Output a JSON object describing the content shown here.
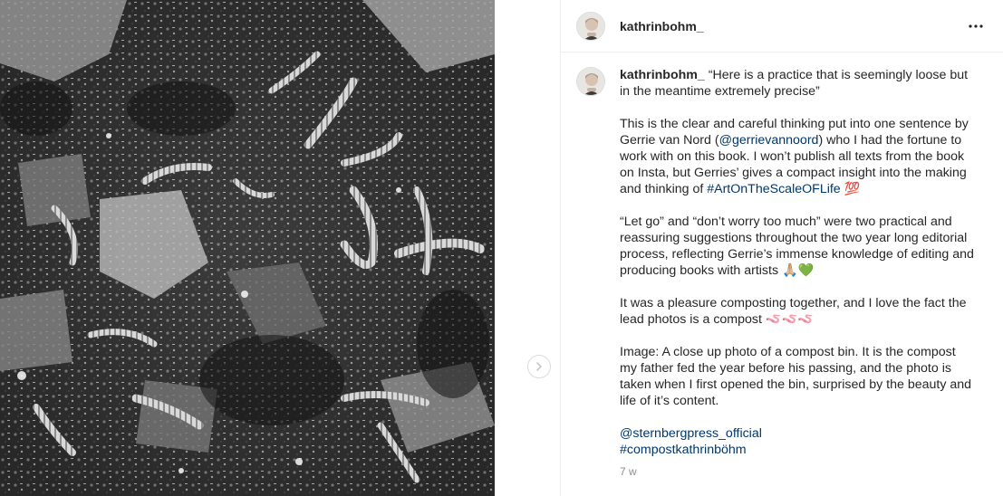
{
  "post": {
    "username": "kathrinbohm_",
    "image_alt": "A close up photo of a compost bin"
  },
  "caption": {
    "username": "kathrinbohm_",
    "p1": "“Here is a practice that is seemingly loose but in the meantime extremely precise”",
    "p2_a": "This is the clear and careful thinking put into one sentence by Gerrie van Nord (",
    "p2_mention": "@gerrievannoord",
    "p2_b": ") who I had the fortune to work with on this book. I won’t publish all texts from the book on Insta, but Gerries’ gives a compact insight into the making and thinking of ",
    "p2_hashtag": "#ArtOnTheScaleOFLife",
    "p2_emoji": "💯",
    "p3": "“Let go” and “don’t worry too much” were two practical and reassuring suggestions throughout the two year long editorial process, reflecting Gerrie’s immense knowledge of editing and producing books with artists ",
    "p3_emoji": "🙏🏼💚",
    "p4": "It was a pleasure composting together, and I love the fact the lead photos is a compost ",
    "p4_emoji": "🪱🪱🪱",
    "p5": "Image: A close up photo of a compost bin. It is the compost my father fed the year before his passing, and the photo is taken when I first opened the bin, surprised by the beauty and life of it’s content.",
    "mention_publisher": "@sternbergpress_official",
    "hashtag_compost": "#compostkathrinböhm",
    "timestamp": "7 w"
  },
  "icons": {
    "more": "more-options-icon",
    "next": "chevron-right-icon"
  },
  "colors": {
    "link": "#00376b",
    "text": "#262626",
    "muted": "#8e8e8e",
    "border": "#efefef"
  }
}
